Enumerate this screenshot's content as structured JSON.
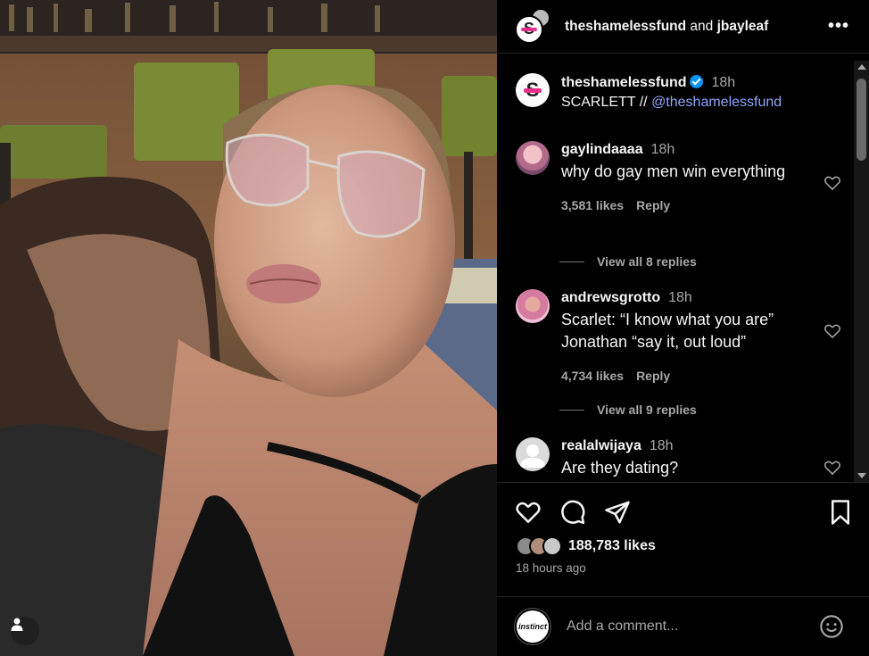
{
  "header": {
    "user1": "theshamelessfund",
    "and_text": "and",
    "user2": "jbayleaf",
    "more": "•••"
  },
  "caption": {
    "username": "theshamelessfund",
    "time": "18h",
    "text": "SCARLETT // ",
    "mention": "@theshamelessfund"
  },
  "comments": [
    {
      "username": "gaylindaaaa",
      "time": "18h",
      "text": "why do gay men win everything",
      "likes": "3,581 likes",
      "reply": "Reply",
      "view_replies": "View all 8 replies"
    },
    {
      "username": "andrewsgrotto",
      "time": "18h",
      "text": "Scarlet: “I know what you are” Jonathan “say it, out loud”",
      "likes": "4,734 likes",
      "reply": "Reply",
      "view_replies": "View all 9 replies"
    },
    {
      "username": "realalwijaya",
      "time": "18h",
      "text": "Are they dating?"
    }
  ],
  "actions": {
    "likes": "188,783 likes",
    "ago": "18 hours ago"
  },
  "add_comment": {
    "avatar_text": "instinct",
    "placeholder": "Add a comment..."
  },
  "icons": {
    "more": "more-icon",
    "heart": "heart-icon",
    "comment": "comment-icon",
    "share": "share-icon",
    "save": "bookmark-icon",
    "emoji": "emoji-icon",
    "tag": "person-icon"
  },
  "colors": {
    "background": "#000000",
    "text": "#f5f5f5",
    "muted": "#a8a8a8",
    "link": "#8fa6ff",
    "verified": "#0095f6",
    "brand_pink": "#e8308c"
  }
}
